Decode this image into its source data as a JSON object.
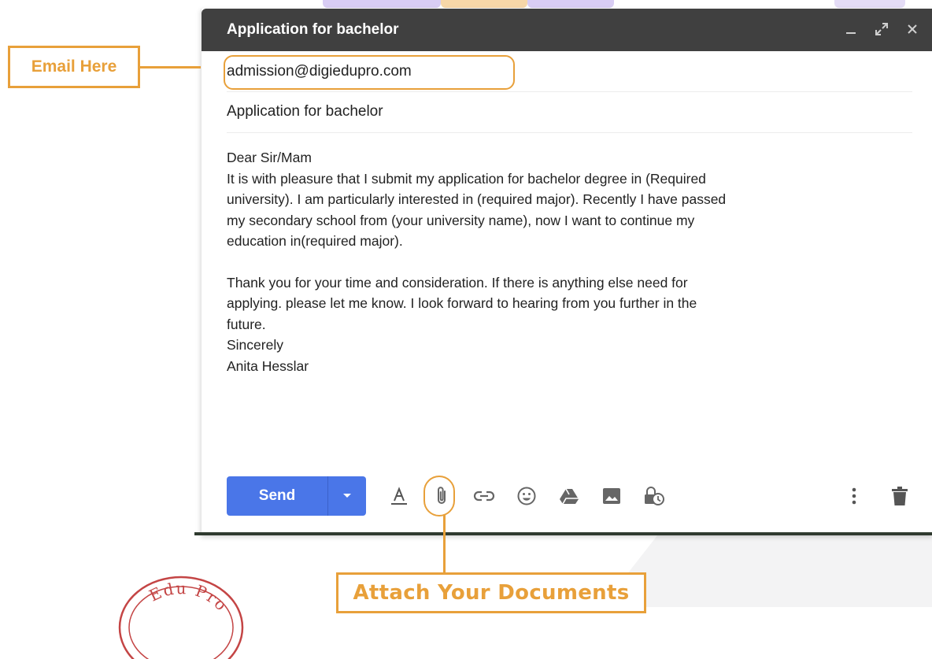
{
  "window": {
    "title": "Application for bachelor"
  },
  "compose": {
    "to_value": "admission@digiedupro.com",
    "subject_value": "Application for bachelor",
    "body": {
      "greeting": "Dear Sir/Mam",
      "paragraph1": "It is with pleasure that I submit my application for bachelor degree in (Required\nuniversity). I am particularly interested in (required major). Recently I have passed\nmy secondary school from (your university name), now I want to continue my\neducation in(required major).",
      "paragraph2": "Thank you for your time and consideration. If there is anything else need for\napplying. please let me know. I look forward to hearing from you further in the\nfuture.",
      "closing": "Sincerely",
      "signature": "Anita Hesslar"
    }
  },
  "toolbar": {
    "send_label": "Send"
  },
  "callouts": {
    "email_here": "Email Here",
    "attach_documents": "Attach Your Documents"
  },
  "stamp": {
    "text": "Edu Pro"
  },
  "icons": {
    "minimize": "minimize-icon",
    "expand": "expand-icon",
    "close": "close-icon",
    "formatting": "text-format-icon",
    "attach": "paperclip-icon",
    "link": "link-icon",
    "emoji": "emoji-icon",
    "drive": "drive-icon",
    "photo": "photo-icon",
    "confidential": "lock-clock-icon",
    "more": "more-vert-icon",
    "trash": "trash-icon",
    "send_options": "chevron-down-icon"
  },
  "colors": {
    "accent_orange": "#e8a03a",
    "send_blue": "#4a76e8",
    "title_bar": "#404040"
  }
}
